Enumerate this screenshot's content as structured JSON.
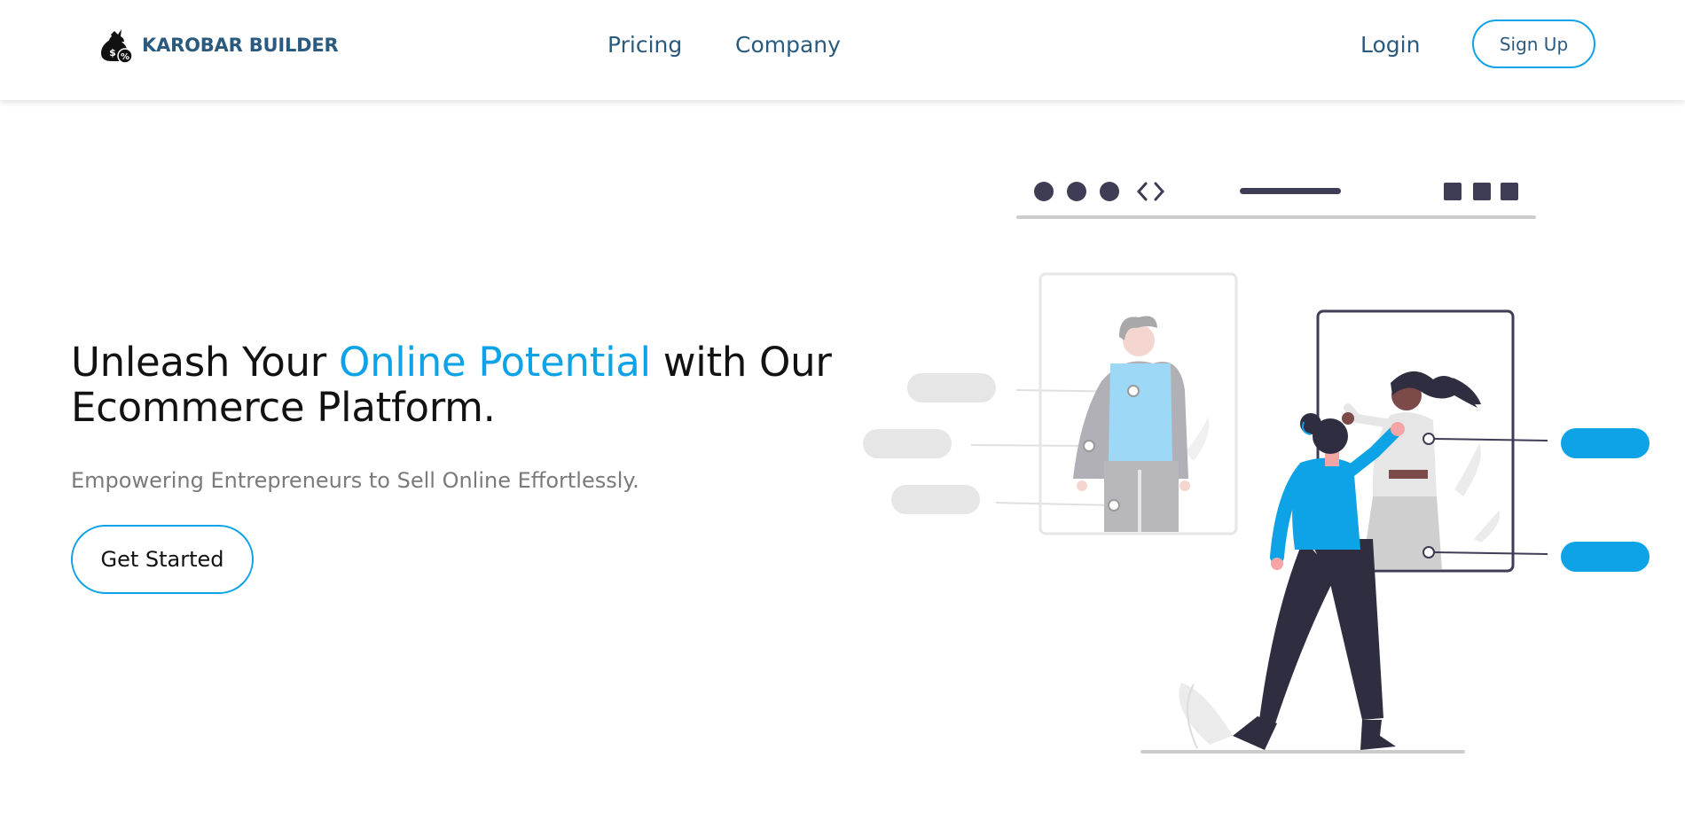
{
  "nav": {
    "brand_name": "KAROBAR BUILDER",
    "logo_icon": "money-bag-icon",
    "links": [
      {
        "label": "Pricing"
      },
      {
        "label": "Company"
      }
    ],
    "login_label": "Login",
    "signup_label": "Sign Up"
  },
  "hero": {
    "title_part1": "Unleash Your ",
    "title_highlight": "Online Potential",
    "title_part2": " with Our Ecommerce Platform.",
    "subtitle": "Empowering Entrepreneurs to Sell Online Effortlessly.",
    "cta_label": "Get Started"
  },
  "illustration": {
    "name": "fashion-ecommerce-illustration"
  },
  "colors": {
    "accent": "#0ea3e6",
    "brand_text": "#2b5a7f",
    "heading_text": "#121212",
    "muted_text": "#7a7a7a",
    "illustration_dark": "#3f3d56",
    "illustration_light_gray": "#e6e6e6"
  }
}
